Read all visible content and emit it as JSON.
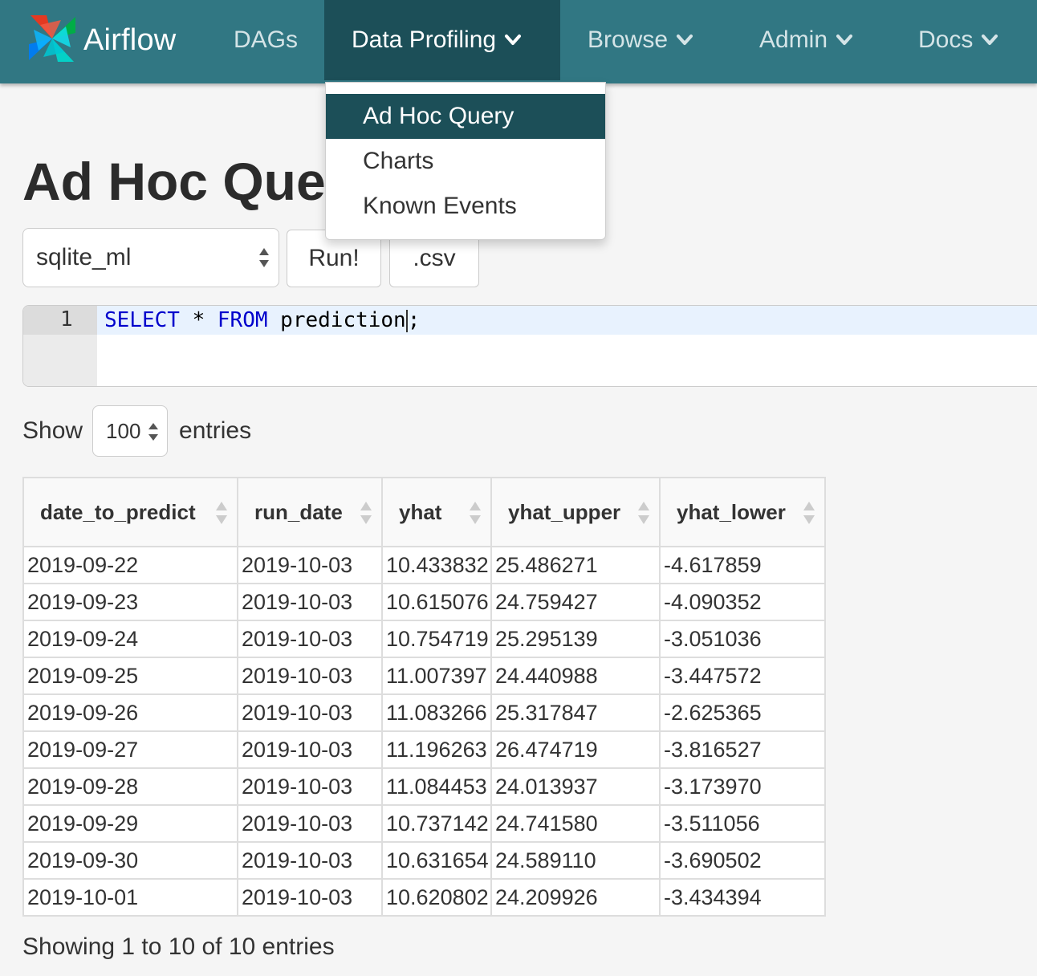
{
  "navbar": {
    "brand": "Airflow",
    "items": [
      {
        "label": "DAGs"
      },
      {
        "label": "Data Profiling"
      },
      {
        "label": "Browse"
      },
      {
        "label": "Admin"
      },
      {
        "label": "Docs"
      }
    ]
  },
  "dropdown": {
    "items": [
      {
        "label": "Ad Hoc Query",
        "active": true
      },
      {
        "label": "Charts"
      },
      {
        "label": "Known Events"
      }
    ]
  },
  "page": {
    "title": "Ad Hoc Query"
  },
  "query_form": {
    "connection": "sqlite_ml",
    "run_label": "Run!",
    "csv_label": ".csv"
  },
  "editor": {
    "line_number": "1",
    "keyword_select": "SELECT",
    "star": "*",
    "keyword_from": "FROM",
    "table_name": "prediction",
    "terminator": ";"
  },
  "entries": {
    "show_label": "Show",
    "page_length": "100",
    "entries_label": "entries"
  },
  "table": {
    "columns": [
      "date_to_predict",
      "run_date",
      "yhat",
      "yhat_upper",
      "yhat_lower"
    ],
    "rows": [
      [
        "2019-09-22",
        "2019-10-03",
        "10.433832",
        "25.486271",
        "-4.617859"
      ],
      [
        "2019-09-23",
        "2019-10-03",
        "10.615076",
        "24.759427",
        "-4.090352"
      ],
      [
        "2019-09-24",
        "2019-10-03",
        "10.754719",
        "25.295139",
        "-3.051036"
      ],
      [
        "2019-09-25",
        "2019-10-03",
        "11.007397",
        "24.440988",
        "-3.447572"
      ],
      [
        "2019-09-26",
        "2019-10-03",
        "11.083266",
        "25.317847",
        "-2.625365"
      ],
      [
        "2019-09-27",
        "2019-10-03",
        "11.196263",
        "26.474719",
        "-3.816527"
      ],
      [
        "2019-09-28",
        "2019-10-03",
        "11.084453",
        "24.013937",
        "-3.173970"
      ],
      [
        "2019-09-29",
        "2019-10-03",
        "10.737142",
        "24.741580",
        "-3.511056"
      ],
      [
        "2019-09-30",
        "2019-10-03",
        "10.631654",
        "24.589110",
        "-3.690502"
      ],
      [
        "2019-10-01",
        "2019-10-03",
        "10.620802",
        "24.209926",
        "-3.434394"
      ]
    ]
  },
  "footer": {
    "info": "Showing 1 to 10 of 10 entries"
  },
  "colors": {
    "navbar": "#317783",
    "nav_active": "#1c4f58",
    "keyword": "#0000cc"
  }
}
